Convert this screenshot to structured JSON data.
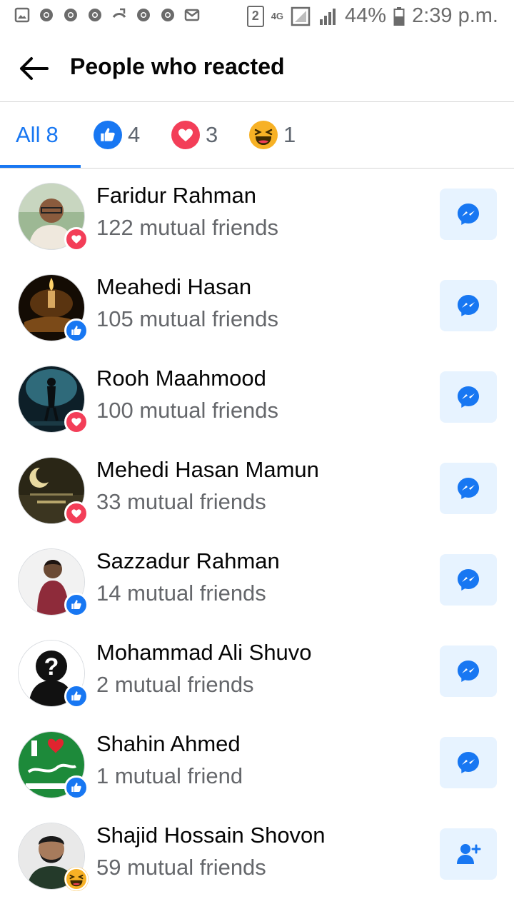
{
  "status_bar": {
    "sim_badge": "2",
    "network": "4G",
    "battery": "44%",
    "time": "2:39 p.m."
  },
  "header": {
    "title": "People who reacted"
  },
  "tabs": [
    {
      "label": "All",
      "count": "8",
      "icon": "all"
    },
    {
      "label": "",
      "count": "4",
      "icon": "like-icon"
    },
    {
      "label": "",
      "count": "3",
      "icon": "love-icon"
    },
    {
      "label": "",
      "count": "1",
      "icon": "haha-icon"
    }
  ],
  "people": [
    {
      "name": "Faridur Rahman",
      "mutual": "122 mutual friends",
      "reaction": "love",
      "action": "messenger-icon"
    },
    {
      "name": "Meahedi Hasan",
      "mutual": "105 mutual friends",
      "reaction": "like",
      "action": "messenger-icon"
    },
    {
      "name": "Rooh Maahmood",
      "mutual": "100 mutual friends",
      "reaction": "love",
      "action": "messenger-icon"
    },
    {
      "name": "Mehedi Hasan Mamun",
      "mutual": "33 mutual friends",
      "reaction": "love",
      "action": "messenger-icon"
    },
    {
      "name": "Sazzadur Rahman",
      "mutual": "14 mutual friends",
      "reaction": "like",
      "action": "messenger-icon"
    },
    {
      "name": "Mohammad Ali Shuvo",
      "mutual": "2 mutual friends",
      "reaction": "like",
      "action": "messenger-icon"
    },
    {
      "name": "Shahin Ahmed",
      "mutual": "1 mutual friend",
      "reaction": "like",
      "action": "messenger-icon"
    },
    {
      "name": "Shajid Hossain Shovon",
      "mutual": "59 mutual friends",
      "reaction": "haha",
      "action": "add-friend-icon"
    }
  ],
  "colors": {
    "accent": "#1877f2",
    "love": "#f33e58",
    "haha": "#f7b125",
    "action_bg": "#e7f3ff"
  }
}
